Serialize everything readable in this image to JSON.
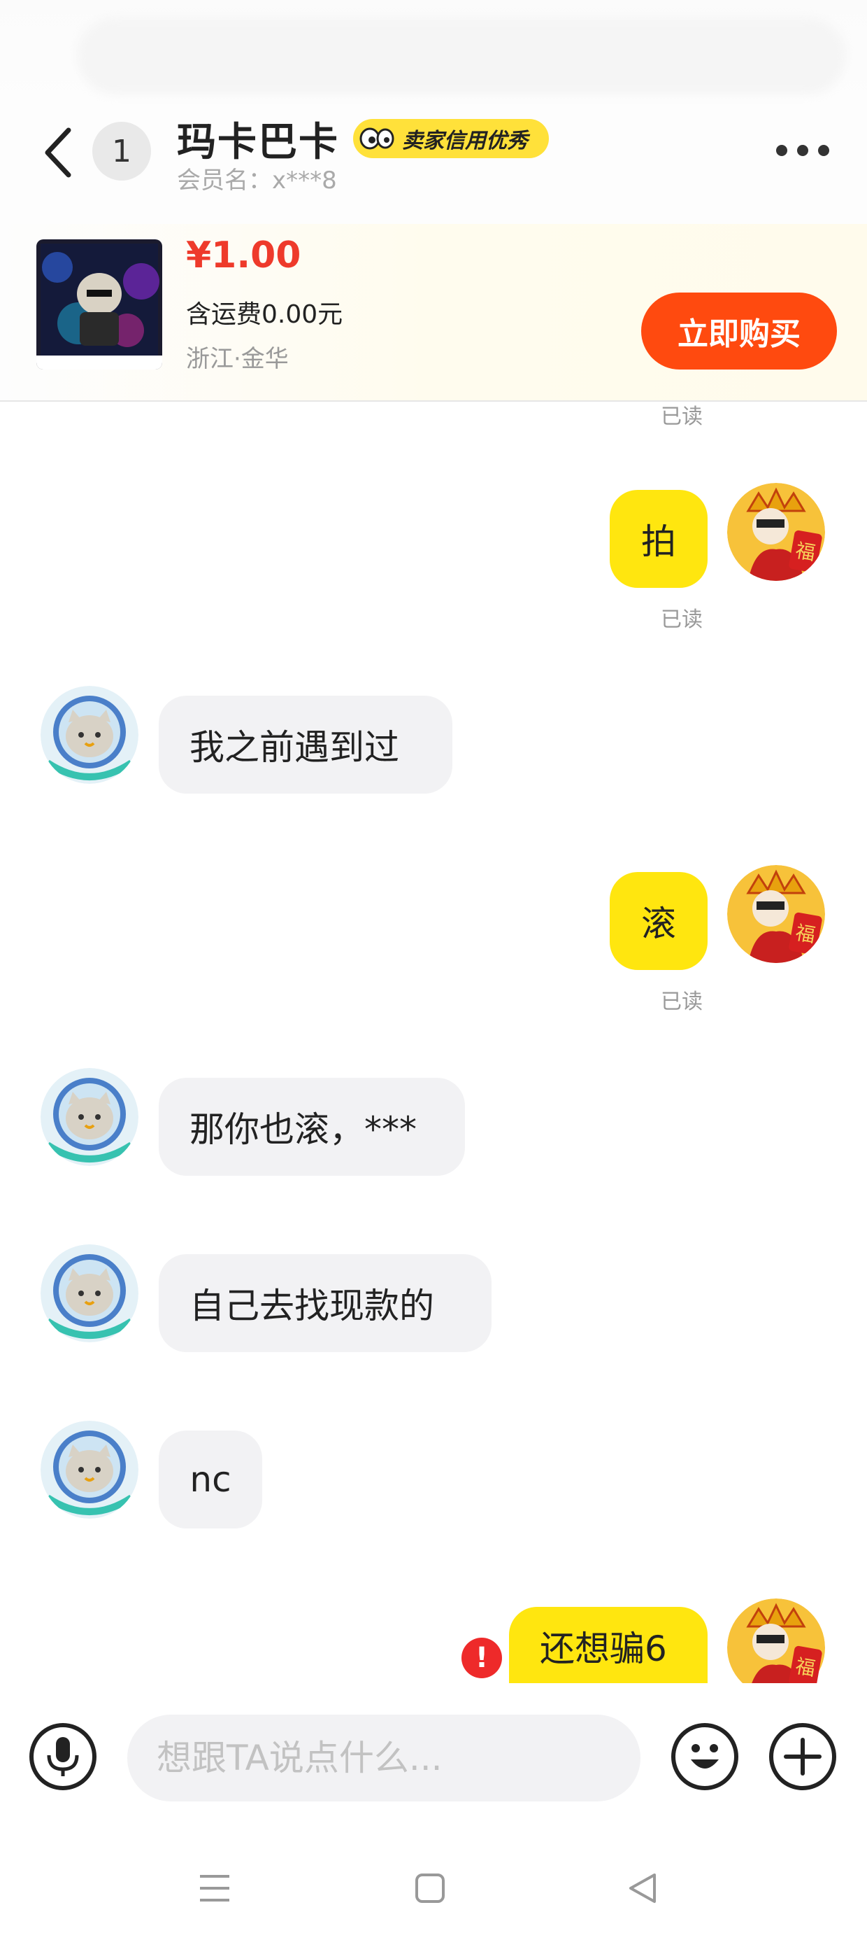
{
  "header": {
    "unread_count": "1",
    "seller_name": "玛卡巴卡",
    "credit_badge": "卖家信用优秀",
    "member_label": "会员名：x***8"
  },
  "product": {
    "price": "¥1.00",
    "shipping": "含运费0.00元",
    "location": "浙江·金华",
    "buy_label": "立即购买"
  },
  "chat": {
    "read_label": "已读",
    "messages": [
      {
        "from": "me",
        "text": "拍"
      },
      {
        "from": "other",
        "text": "我之前遇到过"
      },
      {
        "from": "me",
        "text": "滚"
      },
      {
        "from": "other",
        "text": "那你也滚，***"
      },
      {
        "from": "other",
        "text": "自己去找现款的"
      },
      {
        "from": "other",
        "text": "nc"
      },
      {
        "from": "me",
        "text": "还想骗6"
      }
    ]
  },
  "input": {
    "placeholder": "想跟TA说点什么..."
  },
  "colors": {
    "accent_yellow": "#ffe60f",
    "buy_orange": "#ff4a0f",
    "price_red": "#ee3a2b",
    "error_red": "#ee2a2a"
  },
  "icons": [
    "back-arrow-icon",
    "more-dots-icon",
    "microphone-icon",
    "emoji-icon",
    "plus-icon",
    "error-icon",
    "menu-icon",
    "home-square-icon",
    "back-triangle-icon"
  ]
}
